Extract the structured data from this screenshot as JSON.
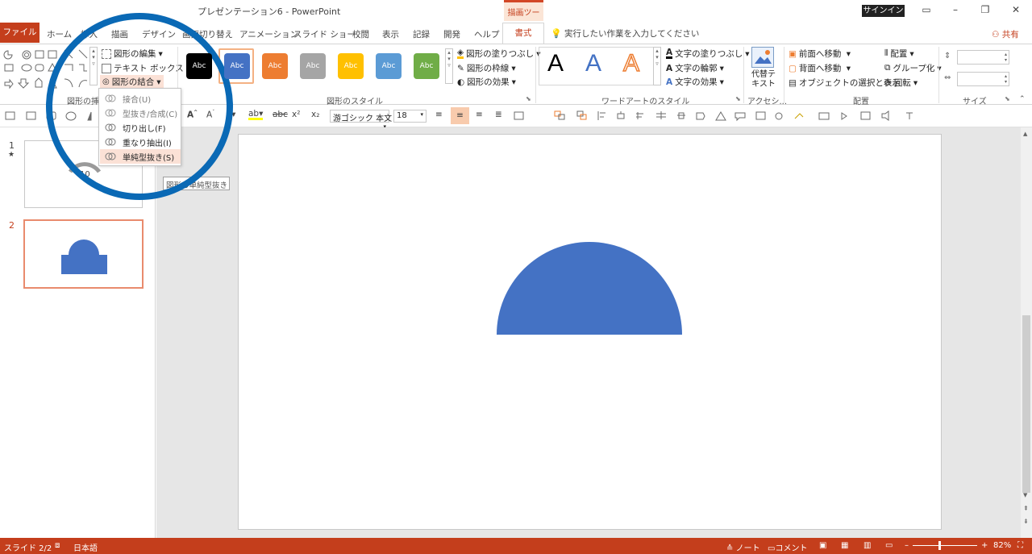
{
  "window": {
    "title": "プレゼンテーション6  -  PowerPoint",
    "context_tab_group": "描画ツール",
    "signin": "サインイン"
  },
  "tabs": {
    "file": "ファイル",
    "home": "ホーム",
    "insert": "挿入",
    "draw": "描画",
    "design": "デザイン",
    "transitions": "画面切り替え",
    "animations": "アニメーション",
    "slideshow": "スライド ショー",
    "review": "校閲",
    "view": "表示",
    "record": "記録",
    "developer": "開発",
    "help": "ヘルプ",
    "format": "書式",
    "tell_me": "実行したい作業を入力してください",
    "share": "共有"
  },
  "ribbon": {
    "edit_shape": "図形の編集",
    "text_box": "テキスト ボックス",
    "merge_shapes": "図形の結合",
    "group_insert_shapes": "図形の挿",
    "group_shape_styles": "図形のスタイル",
    "group_wordart_styles": "ワードアートのスタイル",
    "group_accessibility": "アクセシ...",
    "group_arrange": "配置",
    "group_size": "サイズ",
    "style_swatches": [
      {
        "label": "Abc",
        "color": "#000000"
      },
      {
        "label": "Abc",
        "color": "#4472c4"
      },
      {
        "label": "Abc",
        "color": "#ed7d31"
      },
      {
        "label": "Abc",
        "color": "#a5a5a5"
      },
      {
        "label": "Abc",
        "color": "#ffc000"
      },
      {
        "label": "Abc",
        "color": "#5b9bd5"
      },
      {
        "label": "Abc",
        "color": "#70ad47"
      }
    ],
    "shape_fill": "図形の塗りつぶし",
    "shape_outline": "図形の枠線",
    "shape_effects": "図形の効果",
    "wordart_letter": "A",
    "text_fill": "文字の塗りつぶし",
    "text_outline": "文字の輪郭",
    "text_effects": "文字の効果",
    "alt_text": "代替テキスト",
    "bring_forward": "前面へ移動",
    "send_backward": "背面へ移動",
    "selection_pane": "オブジェクトの選択と表示",
    "align": "配置",
    "group": "グループ化",
    "rotate": "回転"
  },
  "format_bar": {
    "font_name": "游ゴシック 本文",
    "font_size": "18"
  },
  "merge_menu": {
    "items": [
      {
        "label": "接合(U)",
        "state": "disabled"
      },
      {
        "label": "型抜き/合成(C)",
        "state": "disabled"
      },
      {
        "label": "切り出し(F)",
        "state": "enabled"
      },
      {
        "label": "重なり抽出(I)",
        "state": "enabled"
      },
      {
        "label": "単純型抜き(S)",
        "state": "highlighted"
      }
    ],
    "tooltip": "図形の単純型抜き"
  },
  "slides": {
    "items": [
      {
        "number": "1",
        "marker": "★"
      },
      {
        "number": "2",
        "marker": ""
      }
    ],
    "shape_color": "#4472c4"
  },
  "status": {
    "slide_indicator": "スライド 2/2",
    "language": "日本語",
    "notes": "ノート",
    "comments": "コメント",
    "zoom": "82%",
    "accent": "#c43e1c"
  }
}
